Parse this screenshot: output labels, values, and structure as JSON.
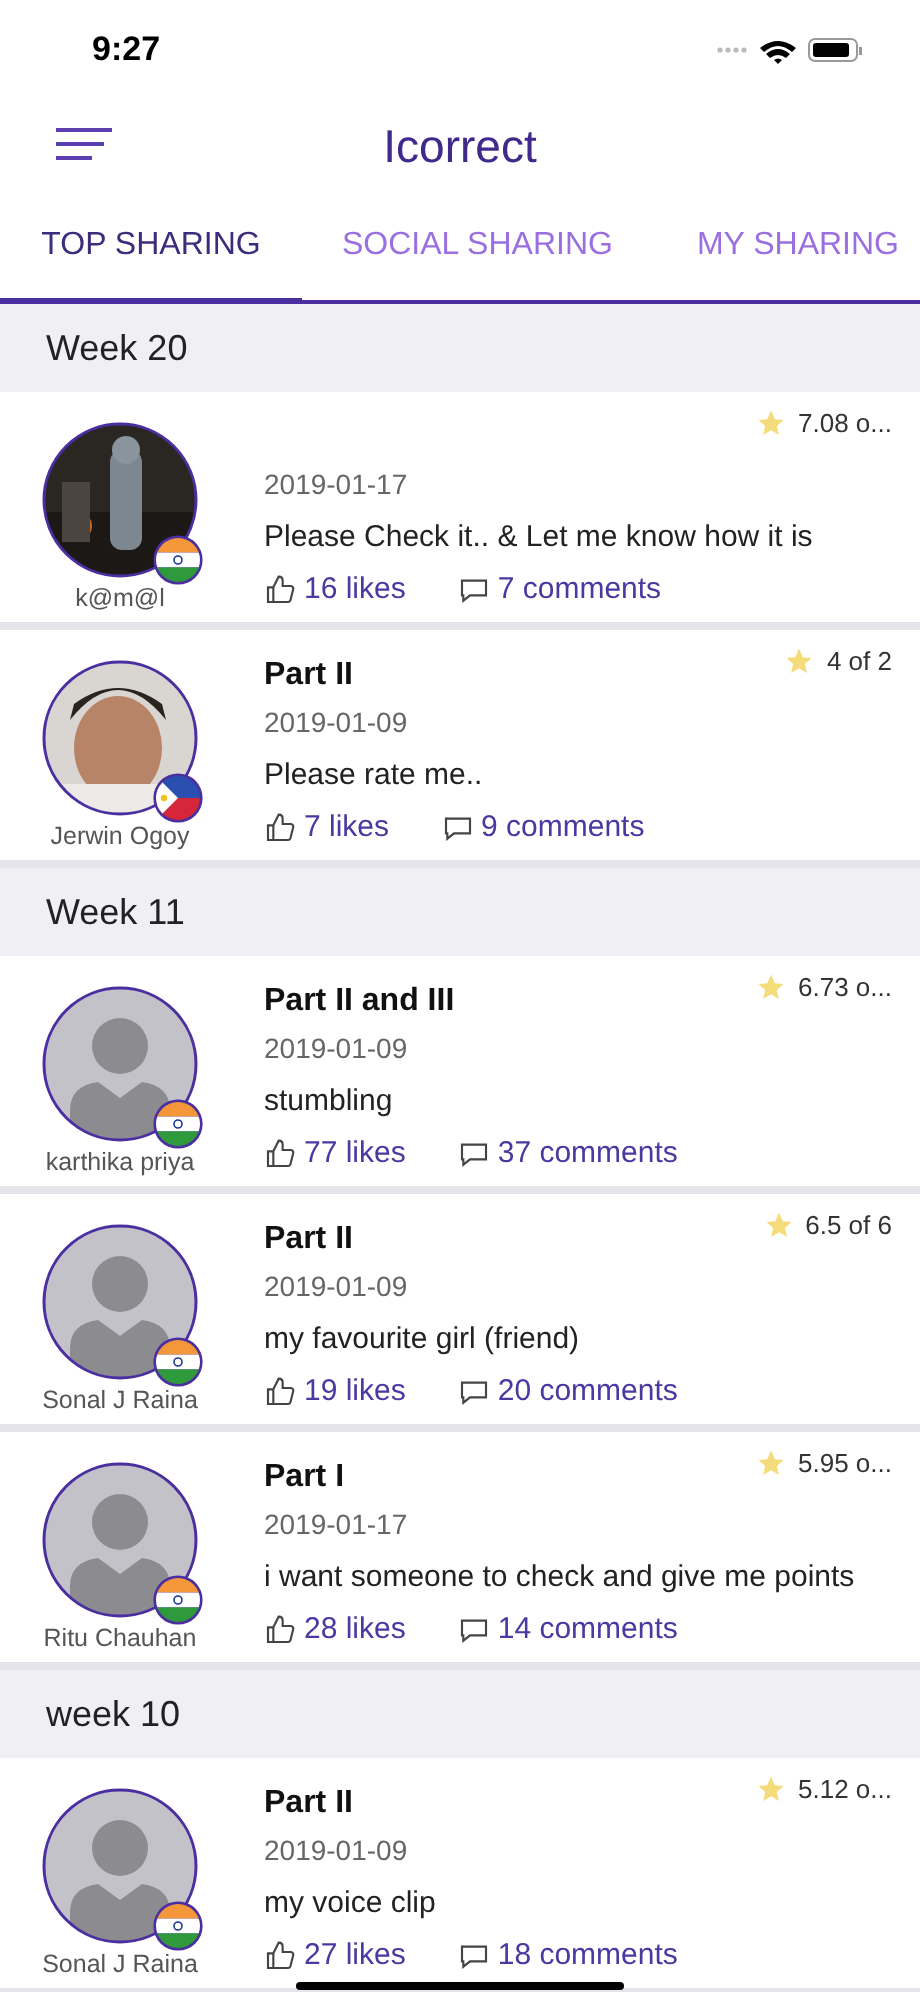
{
  "status_bar": {
    "time": "9:27"
  },
  "header": {
    "title": "Icorrect"
  },
  "tabs": [
    {
      "label": "TOP SHARING",
      "selected": true
    },
    {
      "label": "SOCIAL SHARING",
      "selected": false
    },
    {
      "label": "MY SHARING",
      "selected": false
    }
  ],
  "sections": [
    {
      "title": "Week 20",
      "posts": [
        {
          "user": "k@m@l",
          "flag": {
            "kind": "india"
          },
          "date": "2019-01-17",
          "text": "Please Check it.. & Let me know how it is",
          "score": "7.08 o...",
          "likes": "16 likes",
          "comments": "7 comments"
        },
        {
          "user": "Jerwin Ogoy",
          "flag": {
            "kind": "philippines"
          },
          "title": "Part II",
          "date": "2019-01-09",
          "text": "Please rate me..",
          "score": "4 of 2",
          "likes": "7 likes",
          "comments": "9 comments"
        }
      ]
    },
    {
      "title": "Week 11",
      "posts": [
        {
          "user": "karthika priya",
          "avatar": {
            "kind": "placeholder"
          },
          "flag": {
            "kind": "india"
          },
          "title": "Part II and III",
          "date": "2019-01-09",
          "text": "stumbling",
          "score": "6.73 o...",
          "likes": "77 likes",
          "comments": "37 comments"
        },
        {
          "user": "Sonal J Raina",
          "avatar": {
            "kind": "placeholder"
          },
          "flag": {
            "kind": "india"
          },
          "title": "Part II",
          "date": "2019-01-09",
          "text": "my favourite girl (friend)",
          "score": "6.5 of 6",
          "likes": "19 likes",
          "comments": "20 comments"
        },
        {
          "user": "Ritu Chauhan",
          "avatar": {
            "kind": "placeholder"
          },
          "flag": {
            "kind": "india"
          },
          "title": "Part I",
          "date": "2019-01-17",
          "text": "i want someone to check and give me points",
          "score": "5.95 o...",
          "likes": "28 likes",
          "comments": "14 comments"
        }
      ]
    },
    {
      "title": "week 10",
      "posts": [
        {
          "user": "Sonal J Raina",
          "avatar": {
            "kind": "placeholder"
          },
          "flag": {
            "kind": "india"
          },
          "title": "Part II",
          "date": "2019-01-09",
          "text": "my voice clip",
          "score": "5.12 o...",
          "likes": "27 likes",
          "comments": "18 comments"
        }
      ]
    }
  ]
}
